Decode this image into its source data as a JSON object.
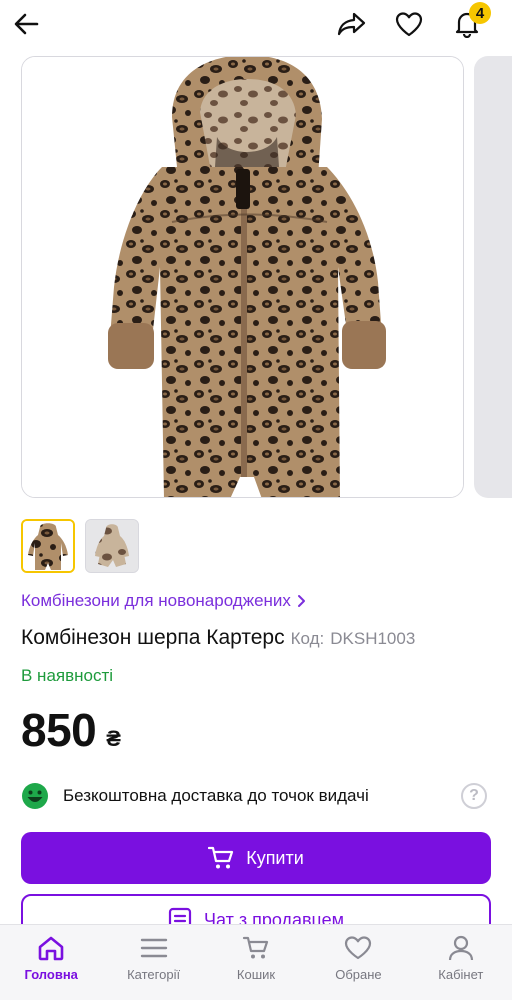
{
  "header": {
    "notification_count": "4"
  },
  "product": {
    "breadcrumb": "Комбінезони для новонароджених",
    "title": "Комбінезон шерпа Картерс",
    "code_label": "Код:",
    "code": "DKSH1003",
    "availability": "В наявності",
    "price": "850",
    "currency": "₴",
    "images_count": 2,
    "selected_image": 1
  },
  "delivery": {
    "text": "Безкоштовна доставка до точок видачі",
    "help_symbol": "?"
  },
  "actions": {
    "buy_label": "Купити",
    "chat_label": "Чат з продавцем"
  },
  "tabbar": {
    "items": [
      {
        "label": "Головна",
        "icon": "home-icon",
        "active": true
      },
      {
        "label": "Категорії",
        "icon": "menu-icon",
        "active": false
      },
      {
        "label": "Кошик",
        "icon": "cart-icon",
        "active": false
      },
      {
        "label": "Обране",
        "icon": "heart-icon",
        "active": false
      },
      {
        "label": "Кабінет",
        "icon": "user-icon",
        "active": false
      }
    ]
  },
  "colors": {
    "accent": "#7a10e0",
    "link": "#7b2fdc",
    "in_stock": "#1e9b3c",
    "badge": "#f6c600"
  }
}
